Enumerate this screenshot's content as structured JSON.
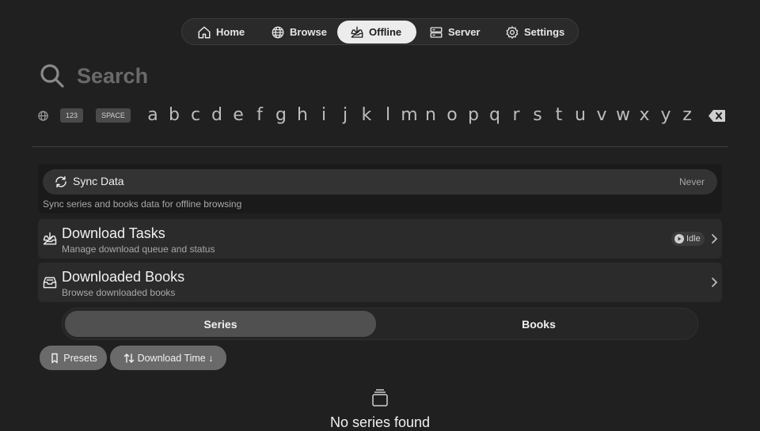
{
  "nav": {
    "items": [
      {
        "label": "Home",
        "icon": "home-icon"
      },
      {
        "label": "Browse",
        "icon": "globe-icon"
      },
      {
        "label": "Offline",
        "icon": "download-tray-icon",
        "active": true
      },
      {
        "label": "Server",
        "icon": "server-icon"
      },
      {
        "label": "Settings",
        "icon": "gear-icon"
      }
    ]
  },
  "search": {
    "placeholder": "Search",
    "value": ""
  },
  "keyboard": {
    "globe_icon": "globe-icon",
    "numeric_key": "123",
    "space_key": "SPACE",
    "letters": [
      "a",
      "b",
      "c",
      "d",
      "e",
      "f",
      "g",
      "h",
      "i",
      "j",
      "k",
      "l",
      "m",
      "n",
      "o",
      "p",
      "q",
      "r",
      "s",
      "t",
      "u",
      "v",
      "w",
      "x",
      "y",
      "z"
    ],
    "backspace_icon": "backspace-icon"
  },
  "sync": {
    "title": "Sync Data",
    "status": "Never",
    "description": "Sync series and books data for offline browsing",
    "icon": "sync-icon"
  },
  "download_tasks": {
    "title": "Download Tasks",
    "subtitle": "Manage download queue and status",
    "status": "Idle",
    "icon": "download-tray-icon"
  },
  "downloaded_books": {
    "title": "Downloaded Books",
    "subtitle": "Browse downloaded books",
    "icon": "inbox-icon"
  },
  "segment": {
    "options": [
      "Series",
      "Books"
    ],
    "selected": "Series"
  },
  "filters": {
    "presets_label": "Presets",
    "sort_label": "Download Time ↓"
  },
  "empty_state": {
    "title": "No series found",
    "icon": "stack-icon"
  },
  "colors": {
    "background": "#202020",
    "active_nav": "#ececec",
    "chip": "#6a6a6a"
  }
}
